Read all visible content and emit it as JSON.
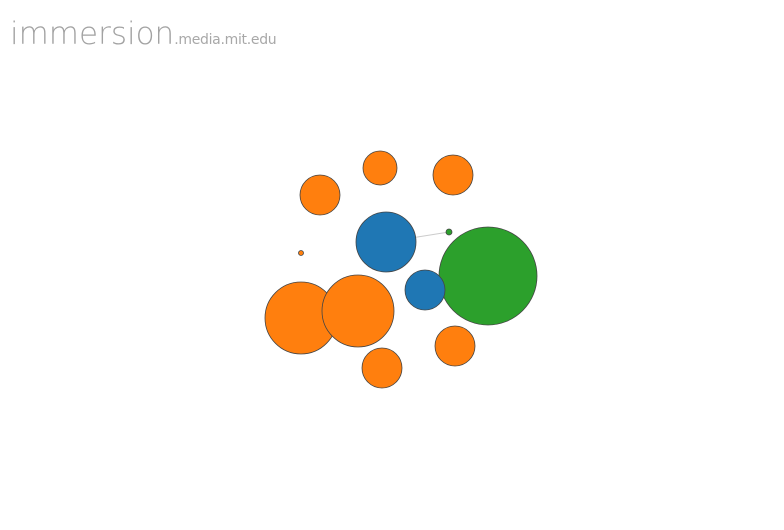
{
  "header": {
    "logo_main": "immersion",
    "logo_domain": ".media.mit.edu"
  },
  "colors": {
    "orange": "#ff7f0e",
    "blue": "#1f77b4",
    "green": "#2ca02c",
    "outline": "#444444",
    "link": "#cccccc"
  },
  "graph": {
    "nodes": [
      {
        "id": "node-1",
        "group": "orange"
      },
      {
        "id": "node-2",
        "group": "orange"
      },
      {
        "id": "node-3",
        "group": "orange"
      },
      {
        "id": "node-4",
        "group": "blue"
      },
      {
        "id": "node-5",
        "group": "green"
      },
      {
        "id": "node-6",
        "group": "orange"
      },
      {
        "id": "node-7",
        "group": "green"
      },
      {
        "id": "node-8",
        "group": "blue"
      },
      {
        "id": "node-9",
        "group": "orange"
      },
      {
        "id": "node-10",
        "group": "orange"
      },
      {
        "id": "node-11",
        "group": "orange"
      },
      {
        "id": "node-12",
        "group": "orange"
      }
    ],
    "links": [
      {
        "source": "node-4",
        "target": "node-5"
      }
    ]
  }
}
